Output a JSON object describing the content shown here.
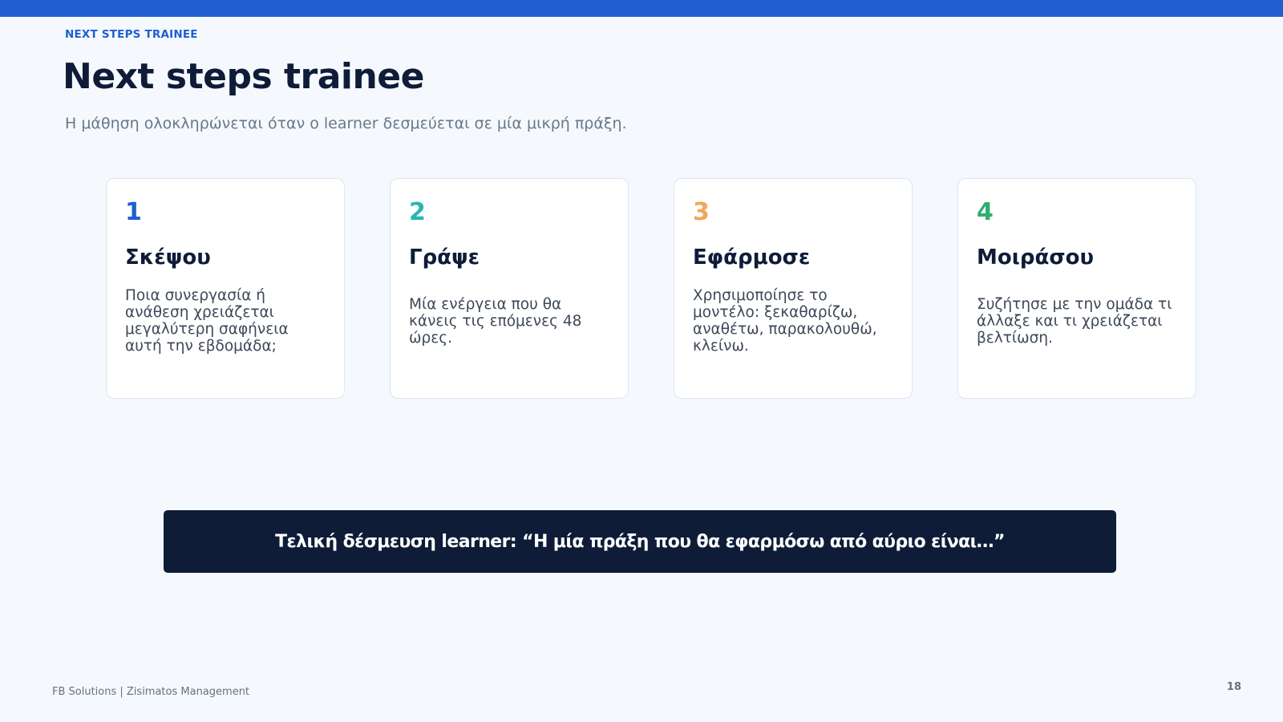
{
  "header": {
    "eyebrow": "NEXT STEPS TRAINEE",
    "title": "Next steps trainee",
    "subtitle": "Η μάθηση ολοκληρώνεται όταν ο learner δεσμεύεται σε μία μικρή πράξη."
  },
  "colors": {
    "accent_blue": "#1f5fd1",
    "teal": "#2bb5b0",
    "orange": "#f2a65a",
    "green": "#2fae6e",
    "navy": "#0e1c38"
  },
  "cards": [
    {
      "number": "1",
      "title": "Σκέψου",
      "body": "Ποια συνεργασία ή ανάθεση χρειάζεται μεγαλύτερη σαφήνεια αυτή την εβδομάδα;",
      "color": "#1f5fd1"
    },
    {
      "number": "2",
      "title": "Γράψε",
      "body": "Μία ενέργεια που θα κάνεις τις επόμενες 48 ώρες.",
      "color": "#2bb5b0"
    },
    {
      "number": "3",
      "title": "Εφάρμοσε",
      "body": "Χρησιμοποίησε το μοντέλο: ξεκαθαρίζω, αναθέτω, παρακολουθώ, κλείνω.",
      "color": "#f2a65a"
    },
    {
      "number": "4",
      "title": "Μοιράσου",
      "body": "Συζήτησε με την ομάδα τι άλλαξε και τι χρειάζεται βελτίωση.",
      "color": "#2fae6e"
    }
  ],
  "banner": {
    "text": "Τελική δέσμευση learner: “Η μία πράξη που θα εφαρμόσω από αύριο είναι…”"
  },
  "footer": {
    "left": "FB Solutions | Zisimatos Management",
    "page_number": "18"
  }
}
